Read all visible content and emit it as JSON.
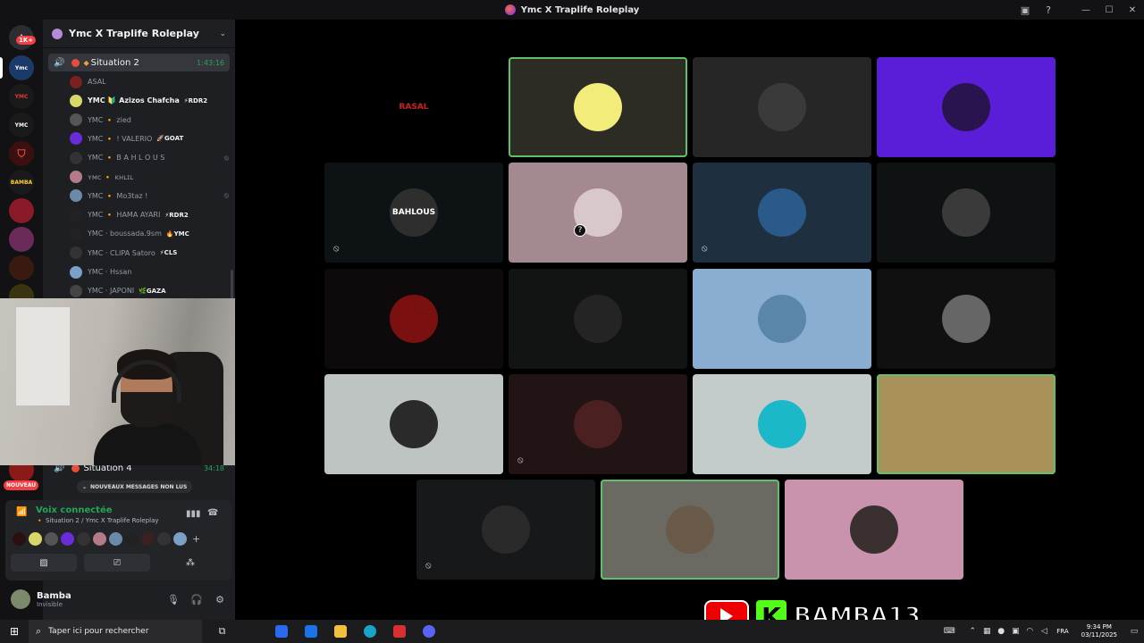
{
  "window": {
    "title": "Ymc X Traplife Roleplay"
  },
  "rail": {
    "badge": "1K+",
    "servers": [
      "Ymc",
      "YMC",
      "YMC",
      "",
      "BAMBA",
      "",
      "",
      ""
    ],
    "nouveau_label": "NOUVEAU"
  },
  "guild": {
    "name": "Ymc X Traplife Roleplay"
  },
  "voice_channels": {
    "situation2": {
      "name": "Situation 2",
      "timer": "1:43:16"
    },
    "situation4": {
      "name": "Situation 4",
      "timer": "34:18"
    }
  },
  "members": [
    {
      "name": "ASAL",
      "tag": "",
      "bright": false,
      "muted": false,
      "color": "#7a2020"
    },
    {
      "name": "YMC 🔰 Azizos Chafcha",
      "tag": "⚡RDR2",
      "bright": true,
      "muted": false,
      "color": "#d8d86a"
    },
    {
      "name": "YMC 🔸 zied",
      "tag": "",
      "bright": false,
      "muted": false,
      "color": "#555"
    },
    {
      "name": "YMC 🔸 ! VALERIO",
      "tag": "🚀GOAT",
      "bright": false,
      "muted": false,
      "color": "#6a2bd8"
    },
    {
      "name": "YMC 🔸 B A H L O U S",
      "tag": "",
      "bright": false,
      "muted": true,
      "color": "#333"
    },
    {
      "name": "ʏᴍᴄ 🔸 ᴋʜʟɪʟ",
      "tag": "",
      "bright": false,
      "muted": false,
      "color": "#b57a8a"
    },
    {
      "name": "YMC 🔸 Mo3taz !",
      "tag": "",
      "bright": false,
      "muted": true,
      "color": "#6a8aaa"
    },
    {
      "name": "YMC 🔸 HAMA AYARI",
      "tag": "⚡RDR2",
      "bright": false,
      "muted": false,
      "color": "#222"
    },
    {
      "name": "YMC · boussada.9sm",
      "tag": "🔥YMC",
      "bright": false,
      "muted": false,
      "color": "#222"
    },
    {
      "name": "YMC · CLIPA Satoro",
      "tag": "⚡CLS",
      "bright": false,
      "muted": false,
      "color": "#333"
    },
    {
      "name": "YMC · Hssan",
      "tag": "",
      "bright": false,
      "muted": false,
      "color": "#7aa0c8"
    },
    {
      "name": "YMC · JAPONI",
      "tag": "🌿GAZA",
      "bright": false,
      "muted": false,
      "color": "#444"
    }
  ],
  "new_messages_label": "NOUVEAUX MESSAGES NON LUS",
  "voice_panel": {
    "status": "Voix connectée",
    "channel": "🔸 Situation 2 / Ymc X Traplife Roleplay"
  },
  "user": {
    "name": "Bamba",
    "status": "Invisible"
  },
  "tiles": [
    {
      "bg": "#000000",
      "av": "#000000",
      "label": "RASAL",
      "speaking": false,
      "muted": false
    },
    {
      "bg": "#2c2b24",
      "av": "#f2ec7a",
      "label": "",
      "speaking": true,
      "muted": false
    },
    {
      "bg": "#262626",
      "av": "#3a3a3a",
      "label": "",
      "speaking": false,
      "muted": false
    },
    {
      "bg": "#5a1ed8",
      "av": "#2a1450",
      "label": "",
      "speaking": false,
      "muted": false
    },
    {
      "bg": "#0d1214",
      "av": "#2e2e2e",
      "label": "BAHLOUS",
      "speaking": false,
      "muted": true
    },
    {
      "bg": "#a48a90",
      "av": "#d8c8cc",
      "label": "",
      "speaking": false,
      "muted": false,
      "question": true
    },
    {
      "bg": "#1e3040",
      "av": "#2a5a8a",
      "label": "",
      "speaking": false,
      "muted": true
    },
    {
      "bg": "#0f1212",
      "av": "#3a3a3a",
      "label": "",
      "speaking": false,
      "muted": false
    },
    {
      "bg": "#0e0a0b",
      "av": "#7a1010",
      "label": "",
      "speaking": false,
      "muted": false
    },
    {
      "bg": "#121414",
      "av": "#242424",
      "label": "",
      "speaking": false,
      "muted": false
    },
    {
      "bg": "#8aaed2",
      "av": "#5a86aa",
      "label": "",
      "speaking": false,
      "muted": false
    },
    {
      "bg": "#101010",
      "av": "#666666",
      "label": "",
      "speaking": false,
      "muted": false
    },
    {
      "bg": "#bec4c2",
      "av": "#2a2a2a",
      "label": "",
      "speaking": false,
      "muted": false
    },
    {
      "bg": "#221314",
      "av": "#4a2020",
      "label": "",
      "speaking": false,
      "muted": true
    },
    {
      "bg": "#c4cccb",
      "av": "#1ab8c8",
      "label": "",
      "speaking": false,
      "muted": false
    },
    {
      "bg": "#a8925a",
      "av": "#a8925a",
      "label": "",
      "speaking": true,
      "muted": false
    },
    {
      "bg": "#17181a",
      "av": "#2a2a2a",
      "label": "",
      "speaking": false,
      "muted": true
    },
    {
      "bg": "#6a6a62",
      "av": "#6a5a4a",
      "label": "",
      "speaking": true,
      "muted": false
    },
    {
      "bg": "#c993ad",
      "av": "#3a3030",
      "label": "",
      "speaking": false,
      "muted": false
    }
  ],
  "brand": {
    "name": "BAMBA13"
  },
  "taskbar": {
    "search_placeholder": "Taper ici pour rechercher",
    "lang": "FRA",
    "time": "9:34 PM",
    "date": "03/11/2025"
  }
}
